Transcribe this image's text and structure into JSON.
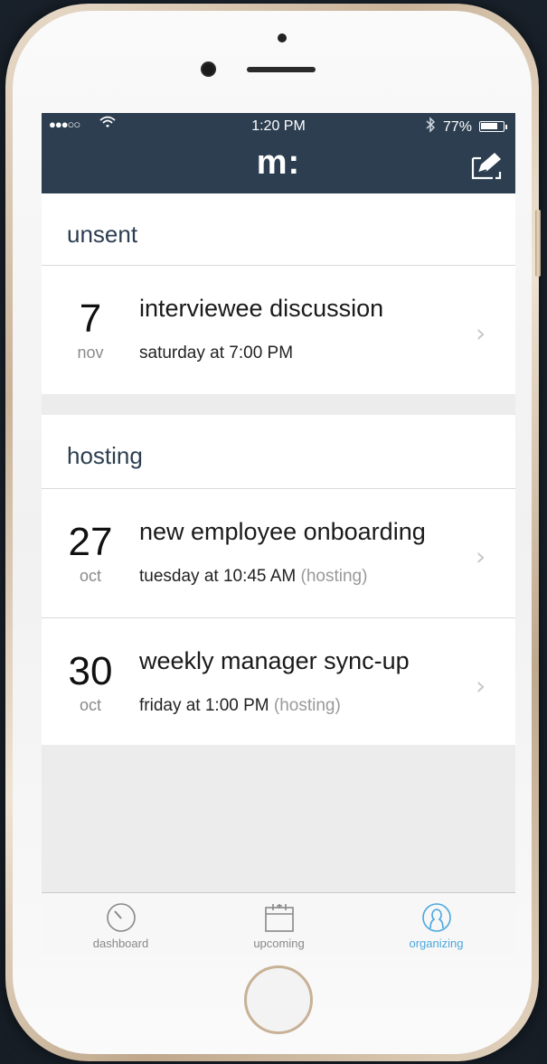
{
  "status_bar": {
    "signal": "●●●○○",
    "time": "1:20 PM",
    "battery_percent": "77%",
    "battery_level": 0.77
  },
  "nav": {
    "logo": "m:"
  },
  "sections": {
    "unsent": {
      "header": "unsent",
      "items": [
        {
          "day": "7",
          "month": "nov",
          "title": "interviewee discussion",
          "subtitle": "saturday at 7:00 PM",
          "extra": ""
        }
      ]
    },
    "hosting": {
      "header": "hosting",
      "items": [
        {
          "day": "27",
          "month": "oct",
          "title": "new employee onboarding",
          "subtitle": "tuesday at 10:45 AM",
          "extra": "(hosting)"
        },
        {
          "day": "30",
          "month": "oct",
          "title": "weekly manager sync-up",
          "subtitle": "friday at 1:00 PM",
          "extra": "(hosting)"
        }
      ]
    }
  },
  "tab_bar": {
    "tabs": [
      {
        "label": "dashboard",
        "icon": "dashboard-icon",
        "active": false
      },
      {
        "label": "upcoming",
        "icon": "calendar-icon",
        "active": false
      },
      {
        "label": "organizing",
        "icon": "organizing-icon",
        "active": true
      }
    ],
    "active_color": "#4aa8de",
    "inactive_color": "#888888"
  },
  "colors": {
    "header_bg": "#2c3e50",
    "list_bg": "#ececec"
  }
}
